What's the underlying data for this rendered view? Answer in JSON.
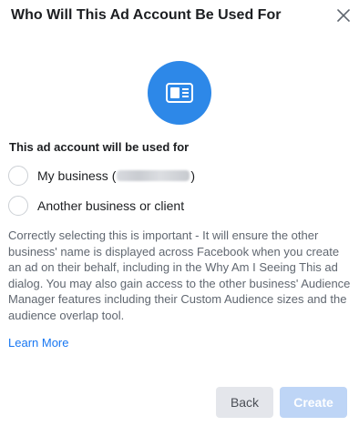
{
  "dialog": {
    "title": "Who Will This Ad Account Be Used For",
    "close_icon": "close-icon",
    "hero_icon": "ad-account-card-icon",
    "accent_color": "#2d88e8"
  },
  "usage": {
    "section_label": "This ad account will be used for",
    "options": [
      {
        "label_prefix": "My business (",
        "label_redacted_text": "",
        "label_suffix": ")",
        "selected": false
      },
      {
        "label": "Another business or client",
        "selected": false
      }
    ]
  },
  "description": "Correctly selecting this is important - It will ensure the other business' name is displayed across Facebook when you create an ad on their behalf, including in the Why Am I Seeing This ad dialog. You may also gain access to the other business' Audience Manager features including their Custom Audience sizes and the audience overlap tool.",
  "learn_more_label": "Learn More",
  "footer": {
    "back_label": "Back",
    "create_label": "Create",
    "create_enabled": false
  }
}
